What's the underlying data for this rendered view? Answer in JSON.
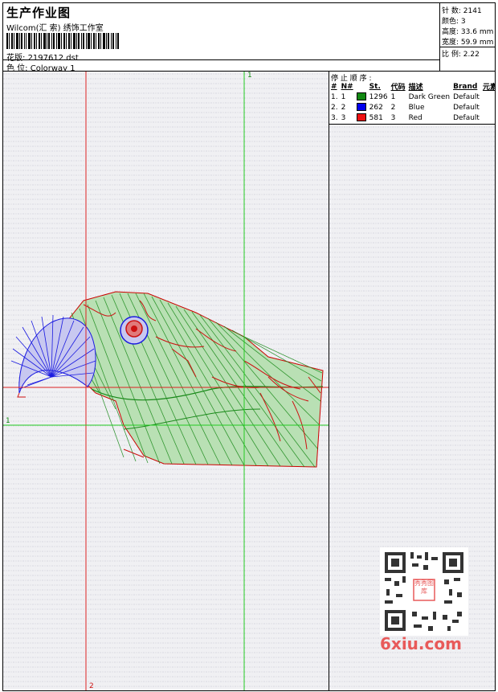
{
  "header": {
    "title": "生产作业图",
    "studio": "Wilcom(汇 索) 绣饰工作室",
    "design_label": "花版:",
    "design_value": "2197612.dst",
    "colorway_label": "色 位:",
    "colorway_value": "Colorway 1"
  },
  "stats": [
    {
      "label": "针 数:",
      "value": "2141"
    },
    {
      "label": "颜色:",
      "value": "3"
    },
    {
      "label": "高度:",
      "value": "33.6 mm"
    },
    {
      "label": "宽度:",
      "value": "59.9 mm"
    },
    {
      "label": "比 例:",
      "value": "2.22"
    }
  ],
  "stop_sequence": {
    "title": "停 止 顺 序 :",
    "columns": [
      "#",
      "N#",
      "St.",
      "代码",
      "描述",
      "Brand",
      "元素"
    ],
    "rows": [
      {
        "index": "1.",
        "n": "1",
        "color": "#118811",
        "stitches": "1296",
        "code": "1",
        "description": "Dark Green",
        "brand": "Default"
      },
      {
        "index": "2.",
        "n": "2",
        "color": "#0000ee",
        "stitches": "262",
        "code": "2",
        "description": "Blue",
        "brand": "Default"
      },
      {
        "index": "3.",
        "n": "3",
        "color": "#ee1111",
        "stitches": "581",
        "code": "3",
        "description": "Red",
        "brand": "Default"
      }
    ]
  },
  "guides": {
    "green_h_label": "1",
    "green_v_label": "1",
    "red_v_label": "2"
  },
  "watermark": {
    "site": "6xiu.com",
    "badge_text": "秀秀图库"
  }
}
